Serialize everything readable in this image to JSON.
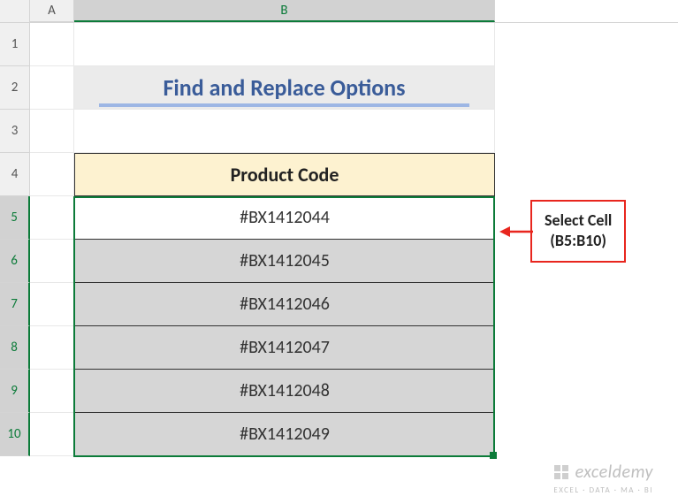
{
  "columns": {
    "A": "A",
    "B": "B"
  },
  "rows": {
    "r1": "1",
    "r2": "2",
    "r3": "3",
    "r4": "4",
    "r5": "5",
    "r6": "6",
    "r7": "7",
    "r8": "8",
    "r9": "9",
    "r10": "10"
  },
  "title": "Find and Replace Options",
  "header": "Product Code",
  "data": {
    "r5": "#BX1412044",
    "r6": "#BX1412045",
    "r7": "#BX1412046",
    "r8": "#BX1412047",
    "r9": "#BX1412048",
    "r10": "#BX1412049"
  },
  "callout": {
    "line1": "Select Cell",
    "line2": "(B5:B10)"
  },
  "watermark": {
    "brand": "exceldemy",
    "tagline": "EXCEL · DATA · MA · BI"
  },
  "chart_data": {
    "type": "table",
    "title": "Find and Replace Options",
    "columns": [
      "Product Code"
    ],
    "rows": [
      [
        "#BX1412044"
      ],
      [
        "#BX1412045"
      ],
      [
        "#BX1412046"
      ],
      [
        "#BX1412047"
      ],
      [
        "#BX1412048"
      ],
      [
        "#BX1412049"
      ]
    ],
    "selection": "B5:B10"
  }
}
